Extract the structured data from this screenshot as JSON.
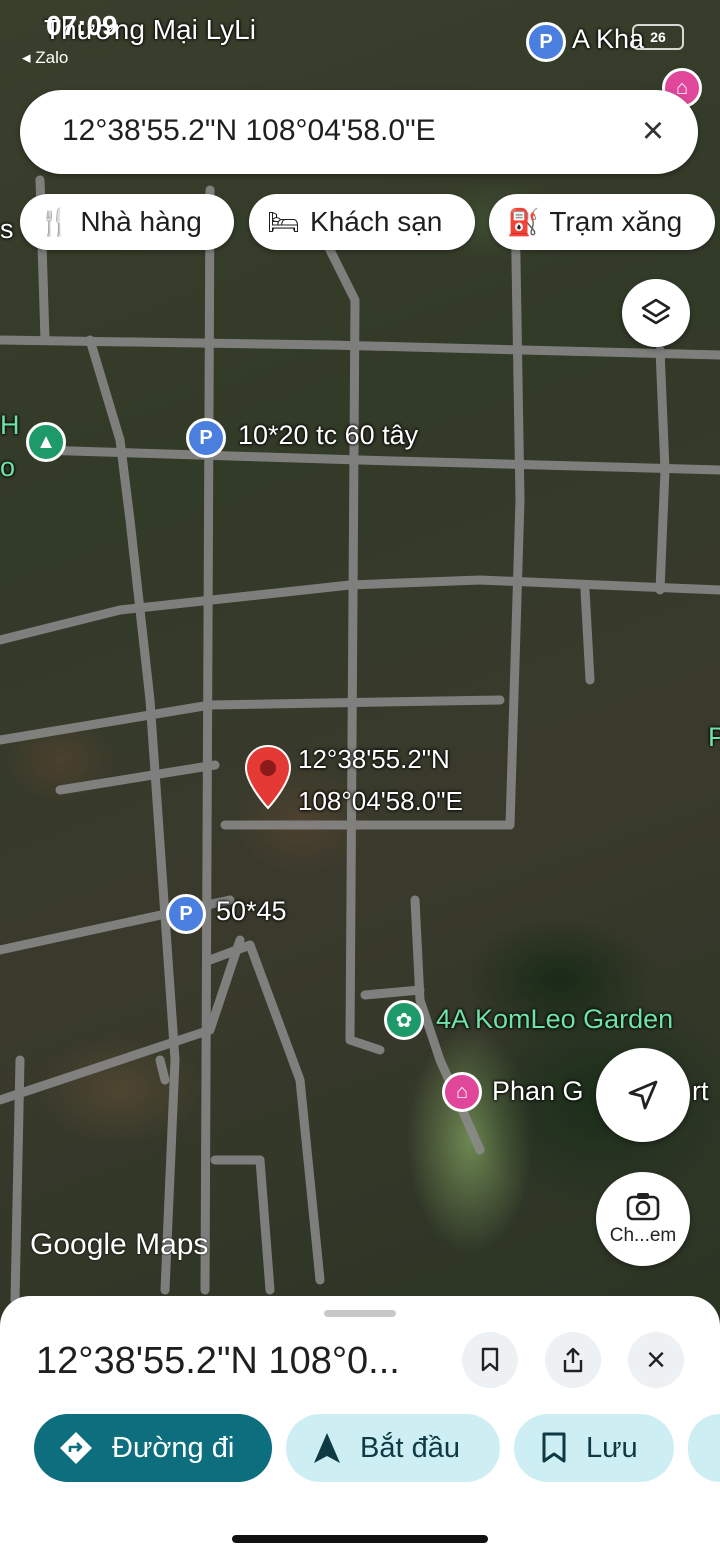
{
  "status_bar": {
    "time": "07:09",
    "back_app": "◂ Zalo",
    "battery": "26"
  },
  "search": {
    "query": "12°38'55.2\"N 108°04'58.0\"E"
  },
  "chips": [
    {
      "icon": "restaurant-icon",
      "label": "Nhà hàng"
    },
    {
      "icon": "hotel-icon",
      "label": "Khách sạn"
    },
    {
      "icon": "gas-station-icon",
      "label": "Trạm xăng"
    }
  ],
  "map": {
    "places": [
      {
        "label": "Thương Mại LyLi",
        "kind": "place"
      },
      {
        "label": "A Kha",
        "kind": "parking"
      },
      {
        "label": "10*20 tc 60 tây",
        "kind": "parking"
      },
      {
        "label": "50*45",
        "kind": "parking"
      },
      {
        "label": "4A KomLeo Garden",
        "kind": "garden"
      },
      {
        "label": "Phan G",
        "kind": "hotel"
      },
      {
        "label": "rt",
        "kind": "hotel"
      }
    ],
    "edge_labels": {
      "left_1": "s",
      "left_2": "H",
      "left_3": "o",
      "right_1": "P"
    },
    "pin": {
      "lat": "12°38'55.2\"N",
      "lng": "108°04'58.0\"E"
    },
    "watermark": "Google Maps",
    "camera_label": "Ch...em"
  },
  "sheet": {
    "title": "12°38'55.2\"N 108°0...",
    "actions": [
      {
        "icon": "directions-icon",
        "label": "Đường đi"
      },
      {
        "icon": "navigation-arrow-icon",
        "label": "Bắt đầu"
      },
      {
        "icon": "bookmark-icon",
        "label": "Lưu"
      }
    ]
  },
  "colors": {
    "primary": "#0d6e7e",
    "secondary": "#cdeef3",
    "pin": "#e53935"
  }
}
